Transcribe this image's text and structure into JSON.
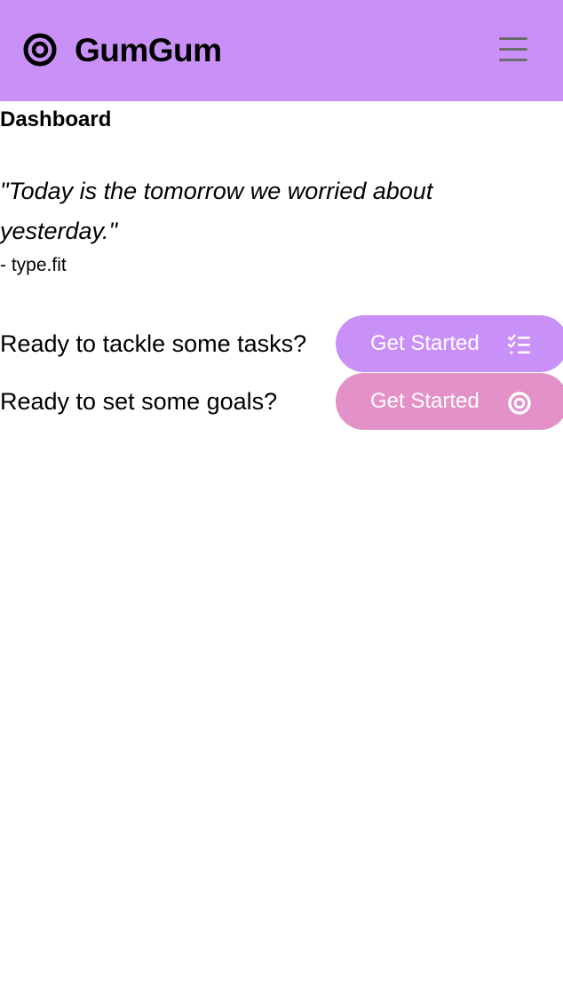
{
  "navbar": {
    "brand_name": "GumGum",
    "brand_icon": "target-icon",
    "menu_icon": "hamburger-menu-icon",
    "background": "#c990f8"
  },
  "page": {
    "title": "Dashboard"
  },
  "quote": {
    "text": "\"Today is the tomorrow we worried about yesterday.\"",
    "author": "- type.fit"
  },
  "cta": [
    {
      "prompt": "Ready to tackle some tasks?",
      "button_label": "Get Started",
      "icon": "checklist-icon",
      "color": "#c990f8"
    },
    {
      "prompt": "Ready to set some goals?",
      "button_label": "Get Started",
      "icon": "target-icon",
      "color": "#e391c8"
    }
  ]
}
